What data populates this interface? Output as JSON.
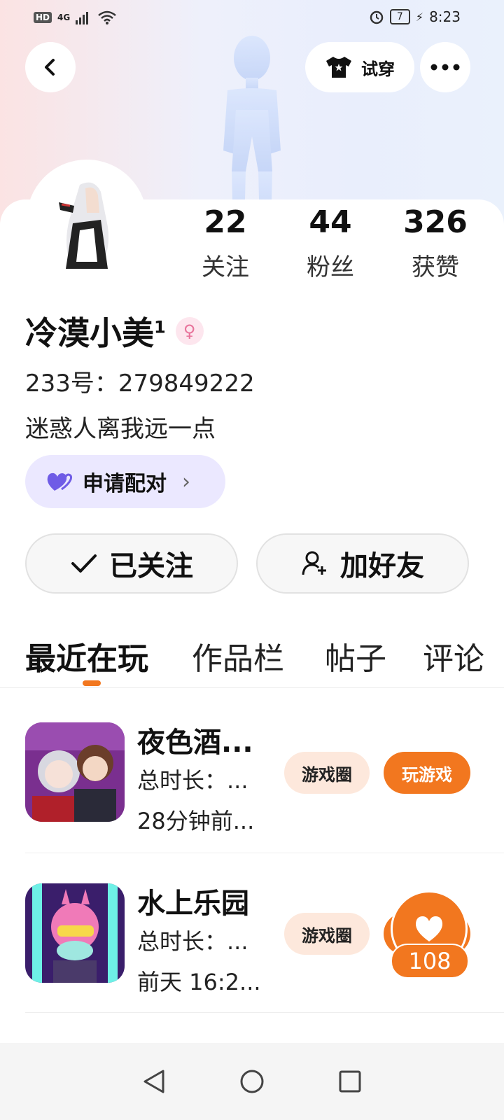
{
  "status_bar": {
    "network_badge": "HD",
    "signal_label": "4G",
    "battery": "7",
    "time": "8:23"
  },
  "header": {
    "back_icon": "chevron-left-icon",
    "try_on_label": "试穿",
    "more_icon": "more-dots-icon"
  },
  "profile": {
    "stats": [
      {
        "value": "22",
        "label": "关注"
      },
      {
        "value": "44",
        "label": "粉丝"
      },
      {
        "value": "326",
        "label": "获赞"
      }
    ],
    "name": "冷漠小美",
    "name_suffix": "1",
    "gender_icon": "female-icon",
    "uid_text": "233号：279849222",
    "bio": "迷惑人离我远一点",
    "pair_label": "申请配对",
    "followed_label": "已关注",
    "add_friend_label": "加好友"
  },
  "tabs": [
    "最近在玩",
    "作品栏",
    "帖子",
    "评论"
  ],
  "games": [
    {
      "title": "夜色酒...",
      "duration": "总时长：...",
      "last_played": "28分钟前...",
      "circle_label": "游戏圈",
      "play_label": "玩游戏"
    },
    {
      "title": "水上乐园",
      "duration": "总时长：...",
      "last_played": "前天 16:2...",
      "circle_label": "游戏圈"
    }
  ],
  "like_badge": {
    "count": "108"
  },
  "colors": {
    "accent": "#f2771f",
    "pair_bg": "#ebe8ff",
    "circle_pill_bg": "#fde8dc"
  }
}
